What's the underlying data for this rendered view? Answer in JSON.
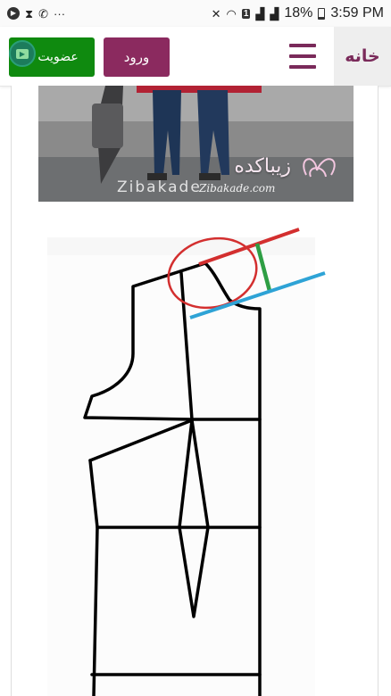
{
  "status_bar": {
    "time": "3:59 PM",
    "battery": "18%",
    "more": "···",
    "sim": "1"
  },
  "navbar": {
    "join_label": "عضویت",
    "login_label": "ورود",
    "home_label": "خانه"
  },
  "colors": {
    "join_button": "#0f8a0f",
    "login_button": "#8b2a5f",
    "brand": "#7a2a5a",
    "annotation_red": "#d32f2f",
    "annotation_green": "#2e9e44",
    "annotation_blue": "#2ea3d6"
  },
  "image": {
    "watermark_fa": "زیباکده",
    "watermark_en": "Zibakade",
    "watermark_url": "Zibakade.com"
  }
}
